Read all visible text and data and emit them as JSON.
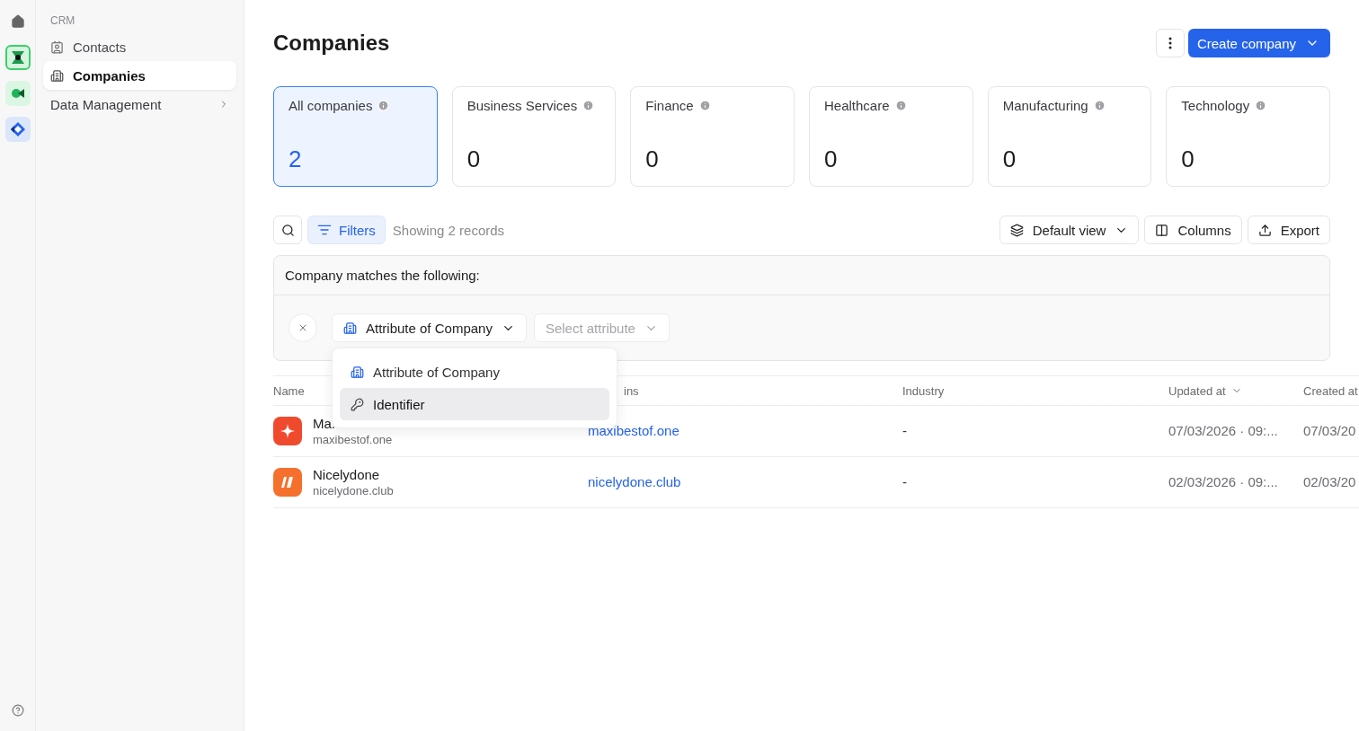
{
  "rail": {
    "apps": [
      {
        "kind": "home",
        "selected": false
      },
      {
        "kind": "crm",
        "selected": true
      },
      {
        "kind": "meet",
        "selected": false
      },
      {
        "kind": "blocks",
        "selected": false
      }
    ]
  },
  "sidebar": {
    "section": "CRM",
    "items": [
      {
        "label": "Contacts",
        "kind": "contact",
        "selected": false
      },
      {
        "label": "Companies",
        "kind": "building",
        "selected": true
      }
    ],
    "groups": [
      {
        "label": "Data Management",
        "expanded": false
      }
    ]
  },
  "page": {
    "title": "Companies",
    "create_button": "Create company"
  },
  "stats": [
    {
      "label": "All companies",
      "value": "2",
      "selected": true
    },
    {
      "label": "Business Services",
      "value": "0",
      "selected": false
    },
    {
      "label": "Finance",
      "value": "0",
      "selected": false
    },
    {
      "label": "Healthcare",
      "value": "0",
      "selected": false
    },
    {
      "label": "Manufacturing",
      "value": "0",
      "selected": false
    },
    {
      "label": "Technology",
      "value": "0",
      "selected": false
    }
  ],
  "toolbar": {
    "filters": "Filters",
    "filters_active": true,
    "record_count": "Showing 2 records",
    "view": "Default view",
    "columns": "Columns",
    "export": "Export"
  },
  "filter_panel": {
    "heading": "Company matches the following:",
    "attribute_select": "Attribute of Company",
    "value_select": {
      "placeholder": "Select attribute"
    },
    "menu": [
      {
        "label": "Attribute of Company",
        "kind": "building",
        "selected": false
      },
      {
        "label": "Identifier",
        "kind": "key",
        "selected": true
      }
    ]
  },
  "table": {
    "columns": [
      {
        "label": "Name",
        "kind": "plain"
      },
      {
        "label": "ins",
        "kind": "plain"
      },
      {
        "label": "Industry",
        "kind": "plain"
      },
      {
        "label": "Updated at",
        "kind": "sorted"
      },
      {
        "label": "Created at",
        "kind": "plain"
      }
    ],
    "rows": [
      {
        "name": "Ma.",
        "subtitle": "maxibestof.one",
        "color": "#f04a2e",
        "kind": "spark",
        "domain": "maxibestof.one",
        "industry": "-",
        "updated": "07/03/2026 · 09:...",
        "created": "07/03/20"
      },
      {
        "name": "Nicelydone",
        "subtitle": "nicelydone.club",
        "color": "#f5702d",
        "kind": "slashes",
        "domain": "nicelydone.club",
        "industry": "-",
        "updated": "02/03/2026 · 09:...",
        "created": "02/03/20"
      }
    ]
  }
}
